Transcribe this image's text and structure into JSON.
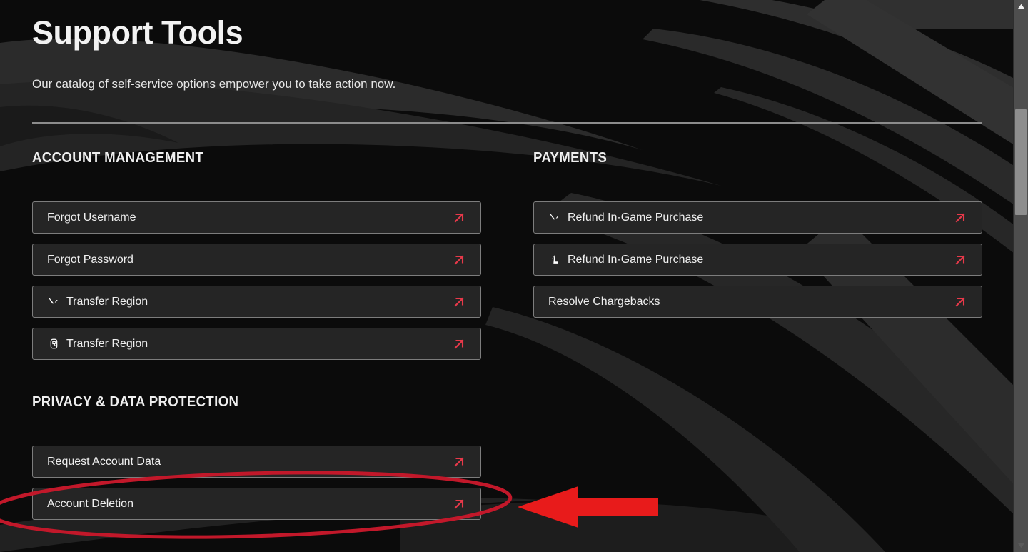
{
  "page": {
    "title": "Support Tools",
    "subtitle": "Our catalog of self-service options empower you to take action now."
  },
  "colors": {
    "accent_red": "#e8394a",
    "annotation_red": "#e01b1b",
    "ellipse_red": "#c2182a",
    "background": "#0b0b0b",
    "button_fill": "#252525",
    "button_border": "#7d7d7d",
    "text": "#efefef",
    "divider": "#8c8c8c"
  },
  "sections": [
    {
      "id": "account-management",
      "heading": "ACCOUNT MANAGEMENT",
      "column": "left",
      "items": [
        {
          "label": "Forgot Username",
          "icon": null,
          "arrow_icon": "external-link-arrow-icon"
        },
        {
          "label": "Forgot Password",
          "icon": null,
          "arrow_icon": "external-link-arrow-icon"
        },
        {
          "label": "Transfer Region",
          "icon": "valorant-icon",
          "arrow_icon": "external-link-arrow-icon"
        },
        {
          "label": "Transfer Region",
          "icon": "riot-game-icon",
          "arrow_icon": "external-link-arrow-icon"
        }
      ]
    },
    {
      "id": "payments",
      "heading": "PAYMENTS",
      "column": "right",
      "items": [
        {
          "label": "Refund In-Game Purchase",
          "icon": "valorant-icon",
          "arrow_icon": "external-link-arrow-icon"
        },
        {
          "label": "Refund In-Game Purchase",
          "icon": "league-of-legends-icon",
          "arrow_icon": "external-link-arrow-icon"
        },
        {
          "label": "Resolve Chargebacks",
          "icon": null,
          "arrow_icon": "external-link-arrow-icon"
        }
      ]
    },
    {
      "id": "privacy-data-protection",
      "heading": "PRIVACY & DATA PROTECTION",
      "column": "left",
      "items": [
        {
          "label": "Request Account Data",
          "icon": null,
          "arrow_icon": "external-link-arrow-icon"
        },
        {
          "label": "Account Deletion",
          "icon": null,
          "arrow_icon": "external-link-arrow-icon"
        }
      ]
    }
  ],
  "annotations": {
    "highlight_ellipse": {
      "target": "Account Deletion",
      "shape": "ellipse",
      "color": "#c2182a"
    },
    "pointer_arrow": {
      "direction": "left",
      "color": "#e01b1b",
      "points_to": "Account Deletion"
    }
  },
  "scrollbar": {
    "up_arrow_icon": "triangle-up-icon",
    "down_arrow_icon": "triangle-down-icon",
    "orientation": "vertical"
  }
}
